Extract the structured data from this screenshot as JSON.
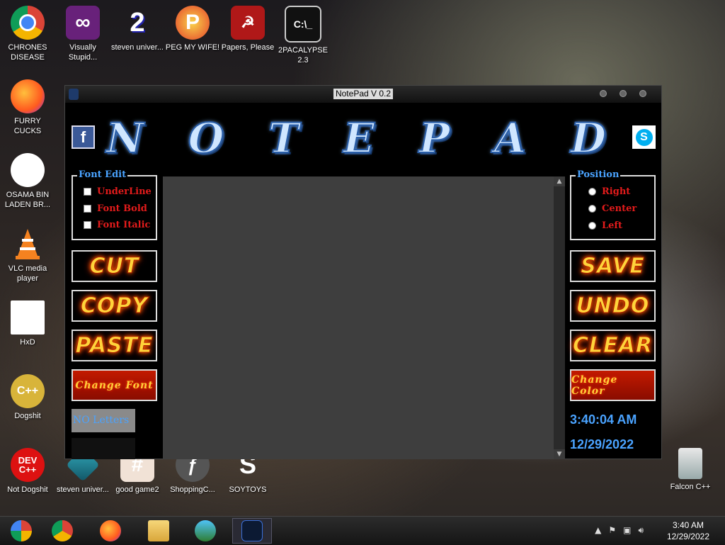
{
  "desktop": {
    "icons": [
      {
        "label": "CHRONES DISEASE",
        "icon": "chrome-icon"
      },
      {
        "label": "Visually Stupid...",
        "icon": "visual-studio-icon"
      },
      {
        "label": "steven univer...",
        "icon": "app-2-icon"
      },
      {
        "label": "PEG MY WIFE!",
        "icon": "peggle-icon"
      },
      {
        "label": "Papers, Please",
        "icon": "papers-please-icon"
      },
      {
        "label": "2PACALYPSE 2.3",
        "icon": "cmd-icon"
      },
      {
        "label": "FURRY CUCKS",
        "icon": "firefox-icon"
      },
      {
        "label": "OSAMA BIN LADEN BR...",
        "icon": "obama-logo-icon"
      },
      {
        "label": "VLC media player",
        "icon": "vlc-icon"
      },
      {
        "label": "HxD",
        "icon": "hxd-icon"
      },
      {
        "label": "Dogshit",
        "icon": "cpp-icon"
      },
      {
        "label": "Not Dogshit",
        "icon": "devcpp-icon"
      },
      {
        "label": "steven univer...",
        "icon": "steven-icon"
      },
      {
        "label": "good game2",
        "icon": "hash-icon"
      },
      {
        "label": "ShoppingC...",
        "icon": "shopping-icon"
      },
      {
        "label": "SOYTOYS",
        "icon": "soytoys-icon"
      },
      {
        "label": "Falcon C++",
        "icon": "recycle-bin-icon"
      }
    ]
  },
  "window": {
    "title": "NotePad V 0.2",
    "logo_letters": [
      "N",
      "O",
      "T",
      "E",
      "P",
      "A",
      "D"
    ],
    "font_edit": {
      "legend": "Font Edit",
      "options": [
        "UnderLine",
        "Font Bold",
        "Font Italic"
      ]
    },
    "position": {
      "legend": "Position",
      "options": [
        "Right",
        "Center",
        "Left"
      ]
    },
    "buttons": {
      "cut": "CUT",
      "copy": "COPY",
      "paste": "PASTE",
      "change_font": "Change Font",
      "save": "SAVE",
      "undo": "UNDO",
      "clear": "CLEAR",
      "change_color": "Change Color"
    },
    "letters_label": "NO Letters",
    "time": "3:40:04 AM",
    "date": "12/29/2022",
    "editor_text": ""
  },
  "taskbar": {
    "clock_time": "3:40 AM",
    "clock_date": "12/29/2022"
  }
}
